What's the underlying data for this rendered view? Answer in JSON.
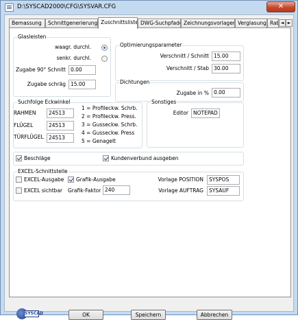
{
  "window": {
    "title": "D:\\SYSCAD2000\\CFG\\SYSVAR.CFG",
    "close_label": "✕"
  },
  "tabs": [
    "Bemassung",
    "Schnittgenerierung",
    "Zuschnittsliste",
    "DWG-Suchpfade",
    "Zeichnungsvorlagen",
    "Verglasung",
    "Rab"
  ],
  "tab_scroll": {
    "left": "◄",
    "right": "►"
  },
  "glasleisten": {
    "title": "Glasleisten",
    "waagr_label": "waagr. durchl.",
    "senkr_label": "senkr. durchl.",
    "zugabe90_label": "Zugabe 90° Schnitt",
    "zugabe90_value": "0.00",
    "zugabe_schraeg_label": "Zugabe schräg",
    "zugabe_schraeg_value": "15.00",
    "waagr_selected": true,
    "senkr_selected": false
  },
  "optimierung": {
    "title": "Optimierungsparameter",
    "verschnitt_schnitt_label": "Verschnitt / Schnitt",
    "verschnitt_schnitt_value": "15.00",
    "verschnitt_stab_label": "Verschnitt / Stab",
    "verschnitt_stab_value": "30.00"
  },
  "dichtungen": {
    "title": "Dichtungen",
    "zugabe_label": "Zugabe in %",
    "zugabe_value": "0.00"
  },
  "suchfolge": {
    "title": "Suchfolge Eckwinkel",
    "rahmen_label": "RAHMEN",
    "rahmen_value": "24513",
    "fluegel_label": "FLÜGEL",
    "fluegel_value": "24513",
    "tuerfluegel_label": "TÜRFLÜGEL",
    "tuerfluegel_value": "24513",
    "legend": [
      "1 = Profileckw. Schrb.",
      "2 = Profileckw. Press.",
      "3 = Gusseckw. Schrb.",
      "4 = Gusseckw. Press",
      "5 = Genagelt"
    ]
  },
  "sonstiges": {
    "title": "Sonstiges",
    "editor_label": "Editor",
    "editor_value": "NOTEPAD"
  },
  "options": {
    "beschlaege_label": "Beschläge",
    "beschlaege_checked": true,
    "kundenverbund_label": "Kundenverbund ausgeben",
    "kundenverbund_checked": true
  },
  "excel": {
    "title": "EXCEL-Schnittstelle",
    "ausgabe_label": "EXCEL-Ausgabe",
    "ausgabe_checked": false,
    "sichtbar_label": "EXCEL sichtbar",
    "sichtbar_checked": false,
    "grafik_ausgabe_label": "Grafik-Ausgabe",
    "grafik_ausgabe_checked": true,
    "grafik_faktor_label": "Grafik-Faktor",
    "grafik_faktor_value": "240",
    "vorlage_position_label": "Vorlage POSITION",
    "vorlage_position_value": "SYSPOS",
    "vorlage_auftrag_label": "Vorlage AUFTRAG",
    "vorlage_auftrag_value": "SYSAUF"
  },
  "buttons": {
    "ok": "OK",
    "speichern": "Speichern",
    "abbrechen": "Abbrechen"
  },
  "logo": {
    "text": "SYSCAD"
  }
}
